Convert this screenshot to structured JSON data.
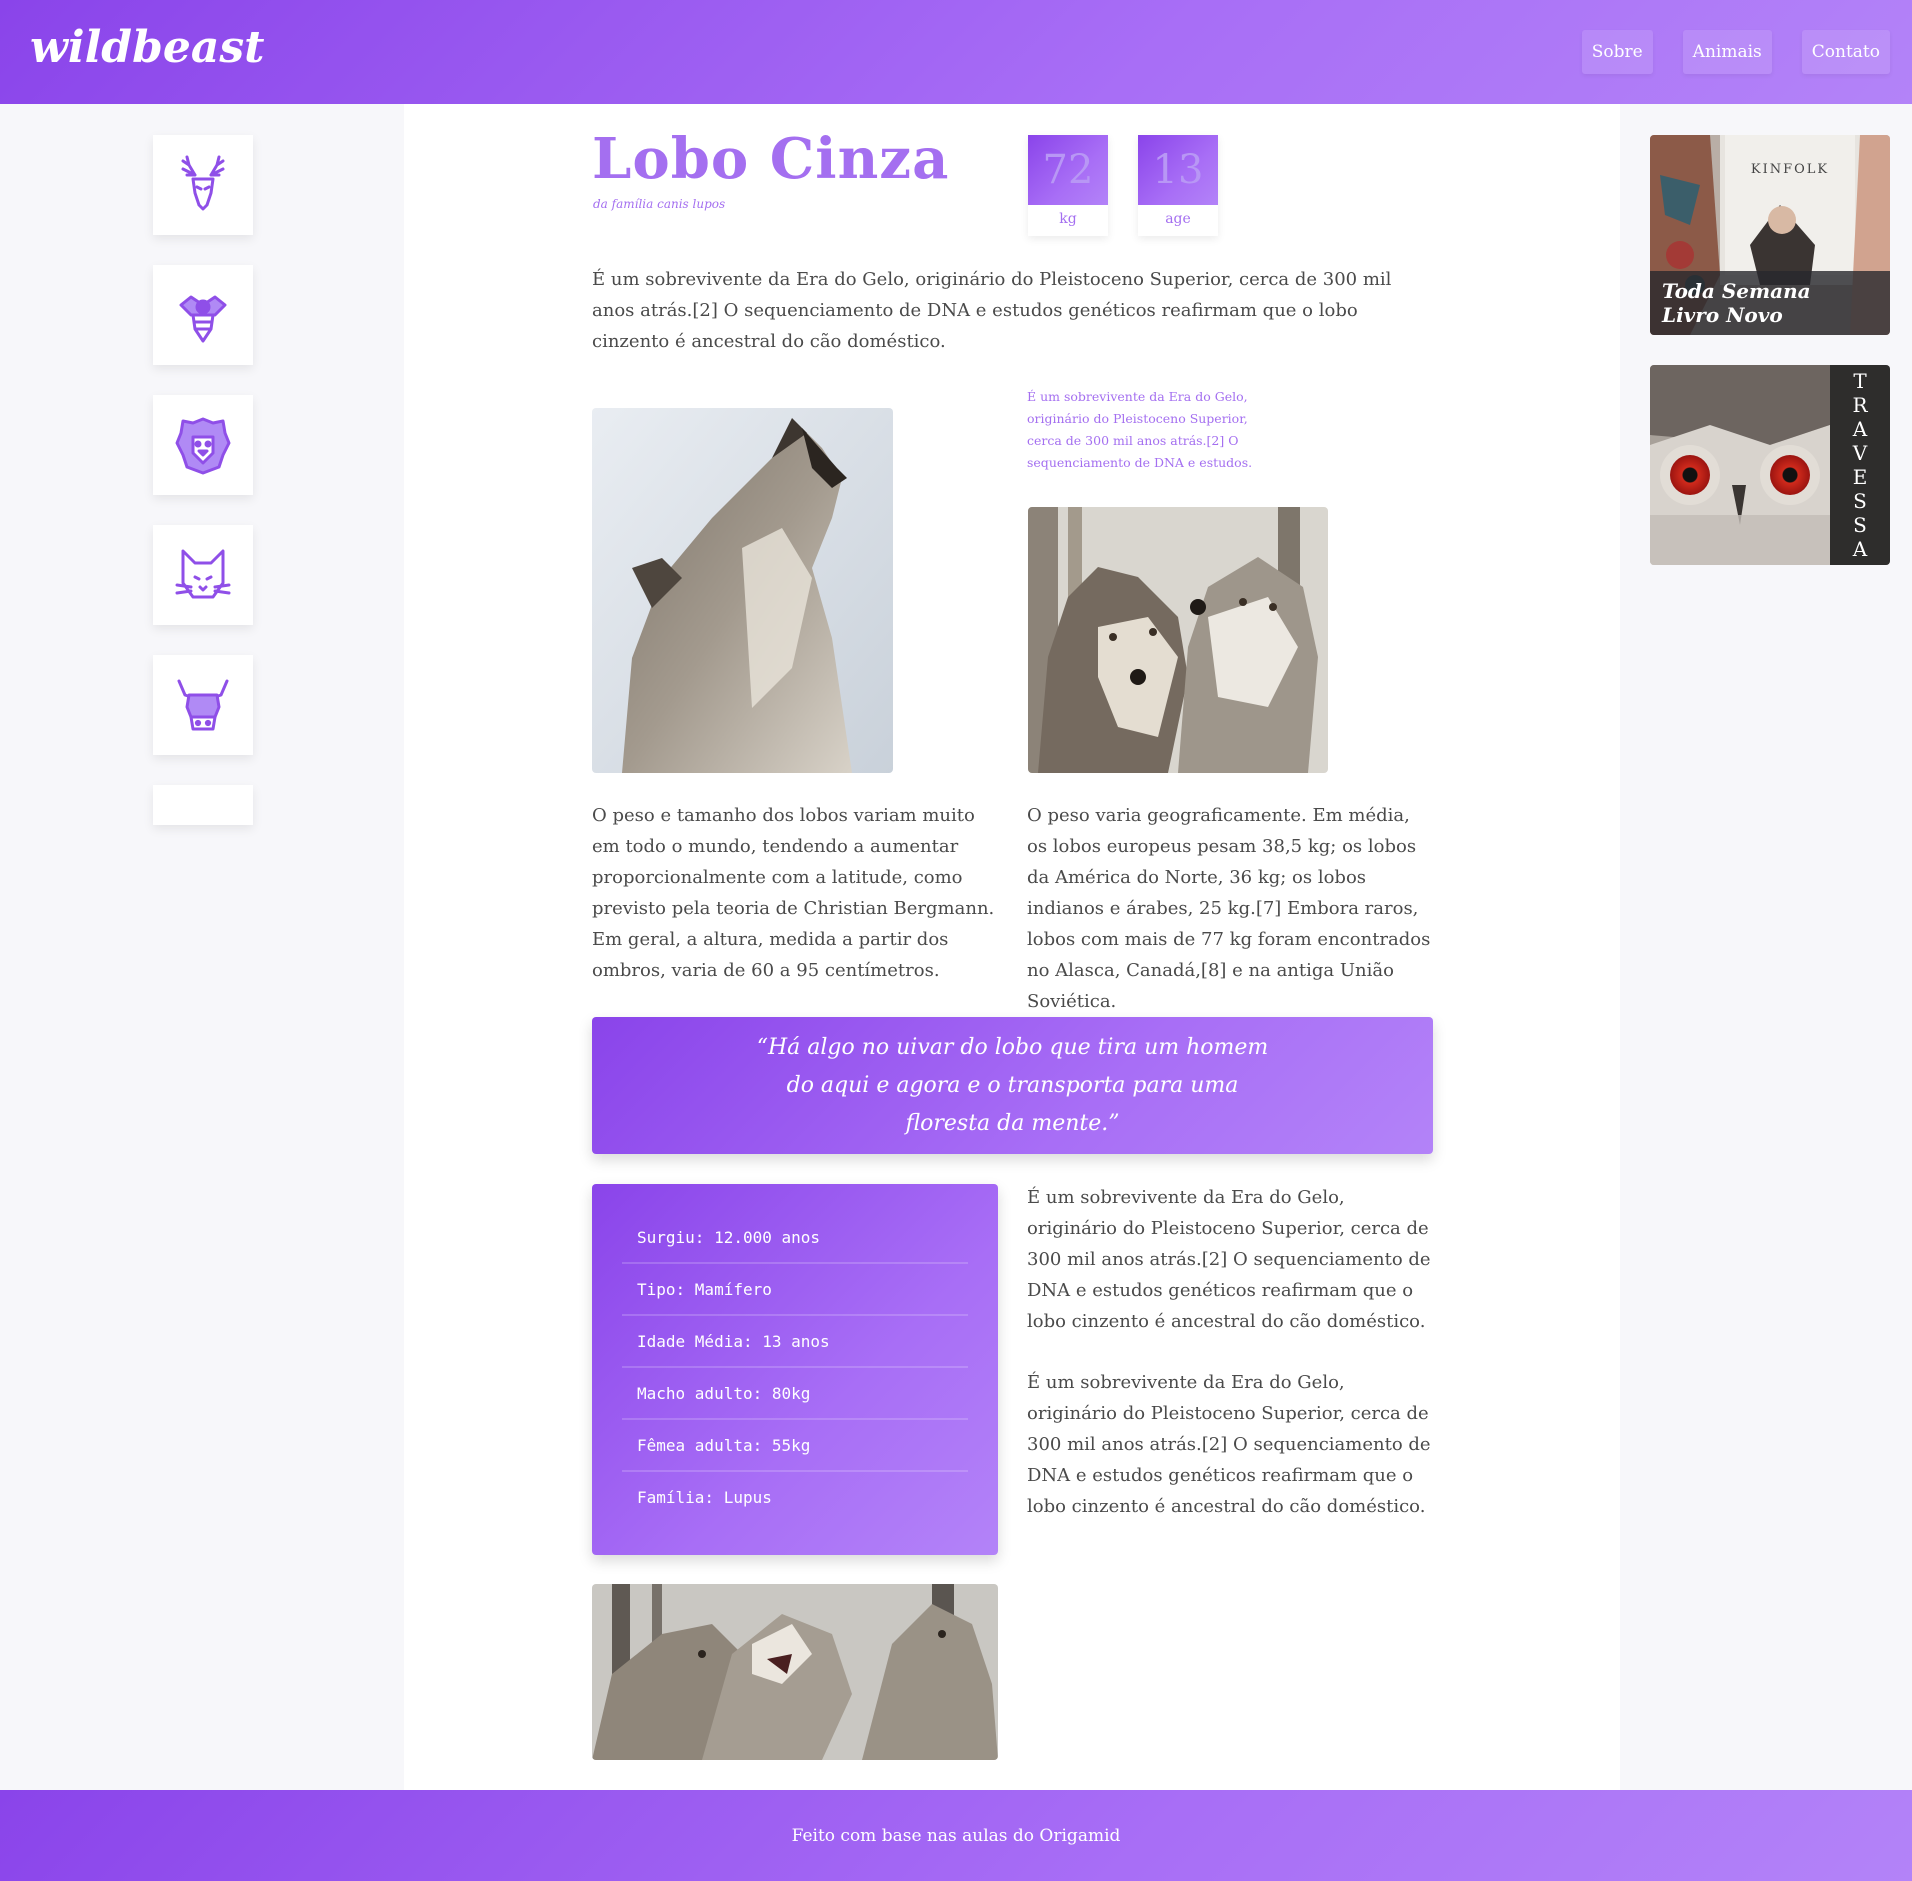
{
  "header": {
    "logo": "wildbeast",
    "nav": [
      "Sobre",
      "Animais",
      "Contato"
    ]
  },
  "sidebar": {
    "icons": [
      "deer-icon",
      "bee-icon",
      "lion-icon",
      "cat-icon",
      "bull-icon"
    ]
  },
  "animal": {
    "name": "Lobo Cinza",
    "family_note": "da família canis lupos",
    "stats": [
      {
        "value": "72",
        "label": "kg"
      },
      {
        "value": "13",
        "label": "age"
      }
    ],
    "intro": "É um sobrevivente da Era do Gelo, originário do Pleistoceno Superior, cerca de 300 mil anos atrás.[2] O sequenciamento de DNA e estudos genéticos reafirmam que o lobo cinzento é ancestral do cão doméstico.",
    "small_note": "É um sobrevivente da Era do Gelo, originário do Pleistoceno Superior, cerca de 300 mil anos atrás.[2] O sequenciamento de DNA e estudos.",
    "col1": "O peso e tamanho dos lobos variam muito em todo o mundo, tendendo a aumentar proporcionalmente com a latitude, como previsto pela teoria de Christian Bergmann. Em geral, a altura, medida a partir dos ombros, varia de 60 a 95 centímetros.",
    "col2": "O peso varia geograficamente. Em média, os lobos europeus pesam 38,5 kg; os lobos da América do Norte, 36 kg; os lobos indianos e árabes, 25 kg.[7] Embora raros, lobos com mais de 77 kg foram encontrados no Alasca, Canadá,[8] e na antiga União Soviética.",
    "quote": "“Há algo no uivar do lobo que tira um homem do aqui e agora e o transporta para uma floresta da mente.”",
    "facts": [
      "Surgiu: 12.000 anos",
      "Tipo: Mamífero",
      "Idade Média: 13 anos",
      "Macho adulto: 80kg",
      "Fêmea adulta: 55kg",
      "Família: Lupus"
    ],
    "col3_p1": "É um sobrevivente da Era do Gelo, originário do Pleistoceno Superior, cerca de 300 mil anos atrás.[2] O sequenciamento de DNA e estudos genéticos reafirmam que o lobo cinzento é ancestral do cão doméstico.",
    "col3_p2": "É um sobrevivente da Era do Gelo, originário do Pleistoceno Superior, cerca de 300 mil anos atrás.[2] O sequenciamento de DNA e estudos genéticos reafirmam que o lobo cinzento é ancestral do cão doméstico."
  },
  "ads": {
    "ad1_brand": "KINFOLK",
    "ad1_caption_line1": "Toda Semana",
    "ad1_caption_line2": "Livro Novo",
    "ad2_letters": [
      "T",
      "R",
      "A",
      "V",
      "E",
      "S",
      "S",
      "A"
    ]
  },
  "footer": {
    "text": "Feito com base nas aulas do Origamid"
  },
  "colors": {
    "accent": "#a46ff0",
    "gradient_start": "#8a44ea",
    "gradient_end": "#b383f8"
  }
}
